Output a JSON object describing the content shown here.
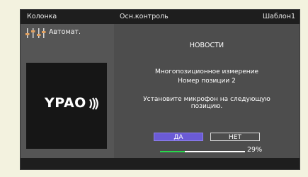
{
  "header": {
    "left": "Колонка",
    "middle": "Осн.контроль",
    "right": "Шаблон1"
  },
  "sidebar": {
    "mode_icon": "equalizer-sliders-icon",
    "mode_label": "Автомат.",
    "logo": {
      "text": "YPAO",
      "icon": "sound-waves-icon"
    }
  },
  "dialog": {
    "heading": "НОВОСТИ",
    "line1": "Многопозиционное измерение",
    "line2": "Номер позиции 2",
    "instruction_line1": "Установите микрофон на следующую",
    "instruction_line2": "позицию.",
    "yes_label": "ДА",
    "no_label": "НЕТ",
    "progress_percent": 29,
    "progress_label": "29%"
  },
  "colors": {
    "panel": "#4d4d4d",
    "bar": "#1e1e1e",
    "accent_selected": "#6b5bd6",
    "progress": "#28d94c",
    "background": "#f3f2df"
  }
}
